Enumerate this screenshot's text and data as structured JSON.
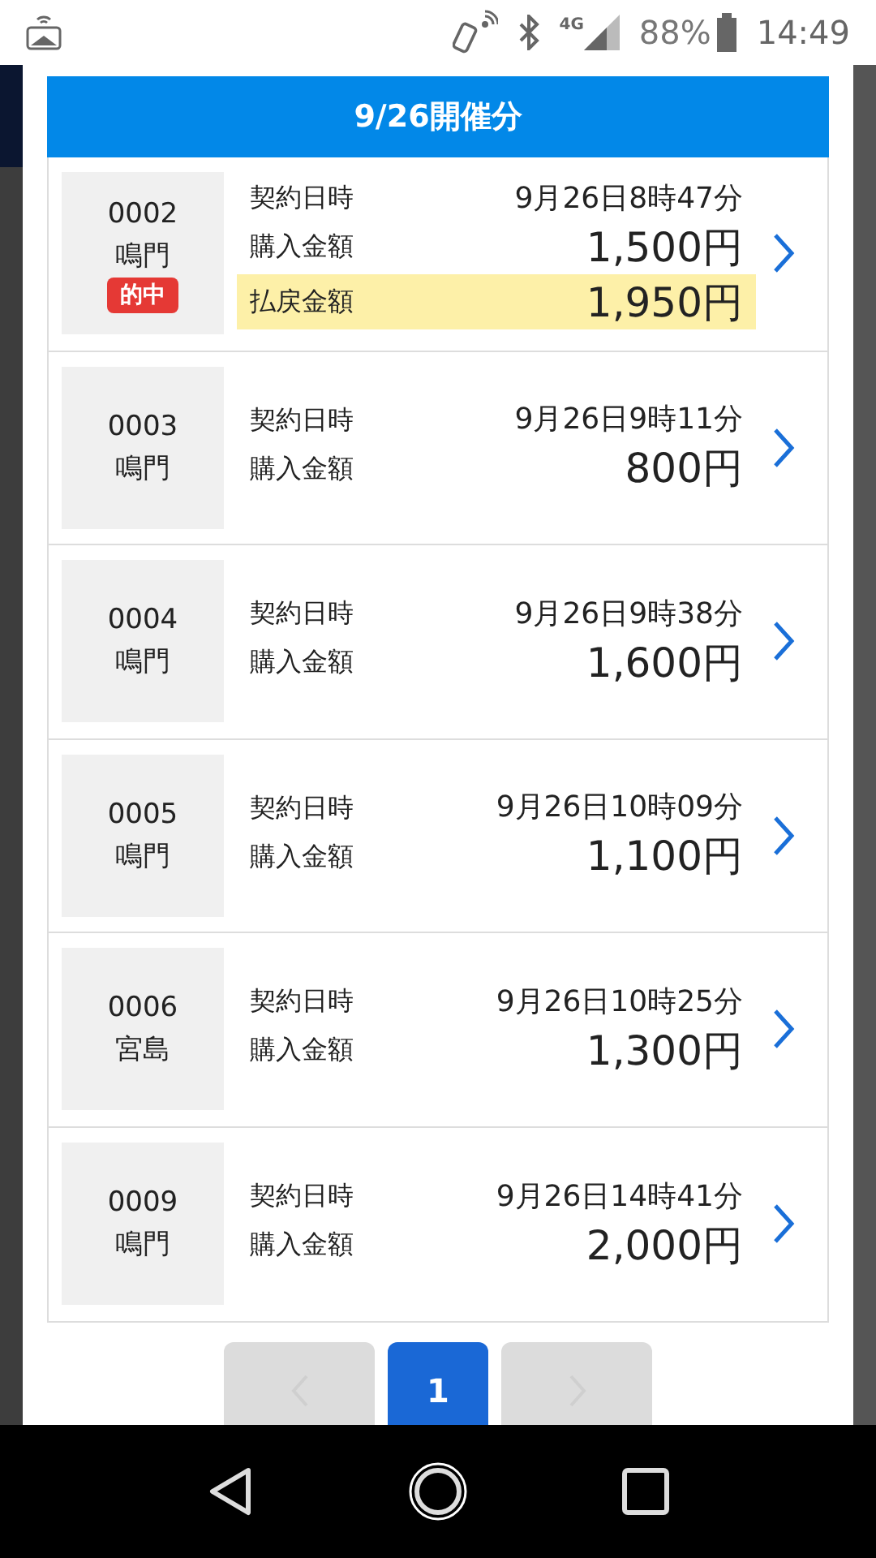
{
  "status_bar": {
    "network": "4G",
    "battery": "88%",
    "time": "14:49"
  },
  "header": {
    "title": "9/26開催分"
  },
  "tickets": [
    {
      "number": "0002",
      "venue": "鳴門",
      "badge": "的中",
      "rows": [
        {
          "kind": "date",
          "label": "契約日時",
          "value": "9月26日8時47分"
        },
        {
          "kind": "amount",
          "label": "購入金額",
          "value": "1,500円"
        },
        {
          "kind": "payout",
          "label": "払戻金額",
          "value": "1,950円"
        }
      ]
    },
    {
      "number": "0003",
      "venue": "鳴門",
      "rows": [
        {
          "kind": "date",
          "label": "契約日時",
          "value": "9月26日9時11分"
        },
        {
          "kind": "amount",
          "label": "購入金額",
          "value": "800円"
        }
      ]
    },
    {
      "number": "0004",
      "venue": "鳴門",
      "rows": [
        {
          "kind": "date",
          "label": "契約日時",
          "value": "9月26日9時38分"
        },
        {
          "kind": "amount",
          "label": "購入金額",
          "value": "1,600円"
        }
      ]
    },
    {
      "number": "0005",
      "venue": "鳴門",
      "rows": [
        {
          "kind": "date",
          "label": "契約日時",
          "value": "9月26日10時09分"
        },
        {
          "kind": "amount",
          "label": "購入金額",
          "value": "1,100円"
        }
      ]
    },
    {
      "number": "0006",
      "venue": "宮島",
      "rows": [
        {
          "kind": "date",
          "label": "契約日時",
          "value": "9月26日10時25分"
        },
        {
          "kind": "amount",
          "label": "購入金額",
          "value": "1,300円"
        }
      ]
    },
    {
      "number": "0009",
      "venue": "鳴門",
      "rows": [
        {
          "kind": "date",
          "label": "契約日時",
          "value": "9月26日14時41分"
        },
        {
          "kind": "amount",
          "label": "購入金額",
          "value": "2,000円"
        }
      ]
    }
  ],
  "pagination": {
    "prev": {
      "disabled": true
    },
    "pages": [
      {
        "label": "1",
        "selected": true
      }
    ],
    "next": {
      "disabled": true
    }
  }
}
